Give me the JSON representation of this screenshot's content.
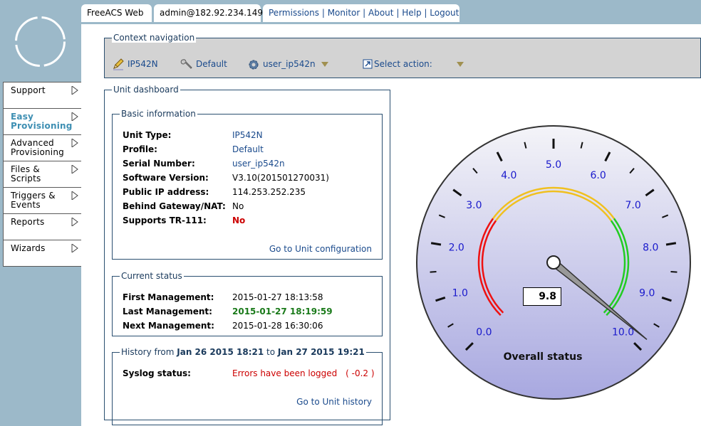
{
  "top_nav": {
    "app_title": "FreeACS Web",
    "user": "admin@182.92.234.149",
    "links": [
      "Permissions",
      "Monitor",
      "About",
      "Help",
      "Logout"
    ]
  },
  "sidebar": {
    "items": [
      {
        "label": "Support",
        "active": false
      },
      {
        "label": "Easy Provisioning",
        "active": true
      },
      {
        "label": "Advanced Provisioning",
        "active": false
      },
      {
        "label": "Files & Scripts",
        "active": false
      },
      {
        "label": "Triggers & Events",
        "active": false
      },
      {
        "label": "Reports",
        "active": false
      },
      {
        "label": "Wizards",
        "active": false
      }
    ]
  },
  "context_nav": {
    "legend": "Context navigation",
    "unit_type": "IP542N",
    "profile": "Default",
    "unit": "user_ip542n",
    "select_action": "Select action:"
  },
  "dashboard": {
    "legend": "Unit dashboard",
    "basic_info": {
      "legend": "Basic information",
      "rows": [
        {
          "key": "Unit Type:",
          "value": "IP542N"
        },
        {
          "key": "Profile:",
          "value": "Default"
        },
        {
          "key": "Serial Number:",
          "value": "user_ip542n"
        },
        {
          "key": "Software Version:",
          "value": "V3.10(201501270031)"
        },
        {
          "key": "Public IP address:",
          "value": "114.253.252.235"
        },
        {
          "key": "Behind Gateway/NAT:",
          "value": "No"
        },
        {
          "key": "Supports TR-111:",
          "value": "No"
        }
      ],
      "link": "Go to Unit configuration"
    },
    "current_status": {
      "legend": "Current status",
      "rows": [
        {
          "key": "First Management:",
          "value": "2015-01-27 18:13:58"
        },
        {
          "key": "Last Management:",
          "value": "2015-01-27 18:19:59"
        },
        {
          "key": "Next Management:",
          "value": "2015-01-28 16:30:06"
        }
      ]
    },
    "history": {
      "legend_prefix": "History from",
      "from": "Jan 26 2015 18:21",
      "legend_mid": "to",
      "to": "Jan 27 2015 19:21",
      "syslog_key": "Syslog status:",
      "syslog_value": "Errors have been logged",
      "syslog_delta": "( -0.2 )",
      "link": "Go to Unit history"
    }
  },
  "gauge": {
    "value": 9.8,
    "display_value": "9.8",
    "title": "Overall status",
    "min": 0,
    "max": 10,
    "tick_labels": [
      "0.0",
      "1.0",
      "2.0",
      "3.0",
      "4.0",
      "5.0",
      "6.0",
      "7.0",
      "8.0",
      "9.0",
      "10.0"
    ],
    "bands": [
      {
        "from": 0,
        "to": 3,
        "color": "#ee1111"
      },
      {
        "from": 3,
        "to": 7,
        "color": "#f0c020"
      },
      {
        "from": 7,
        "to": 10,
        "color": "#22cc22"
      }
    ],
    "label_color": "#1a1acc"
  }
}
